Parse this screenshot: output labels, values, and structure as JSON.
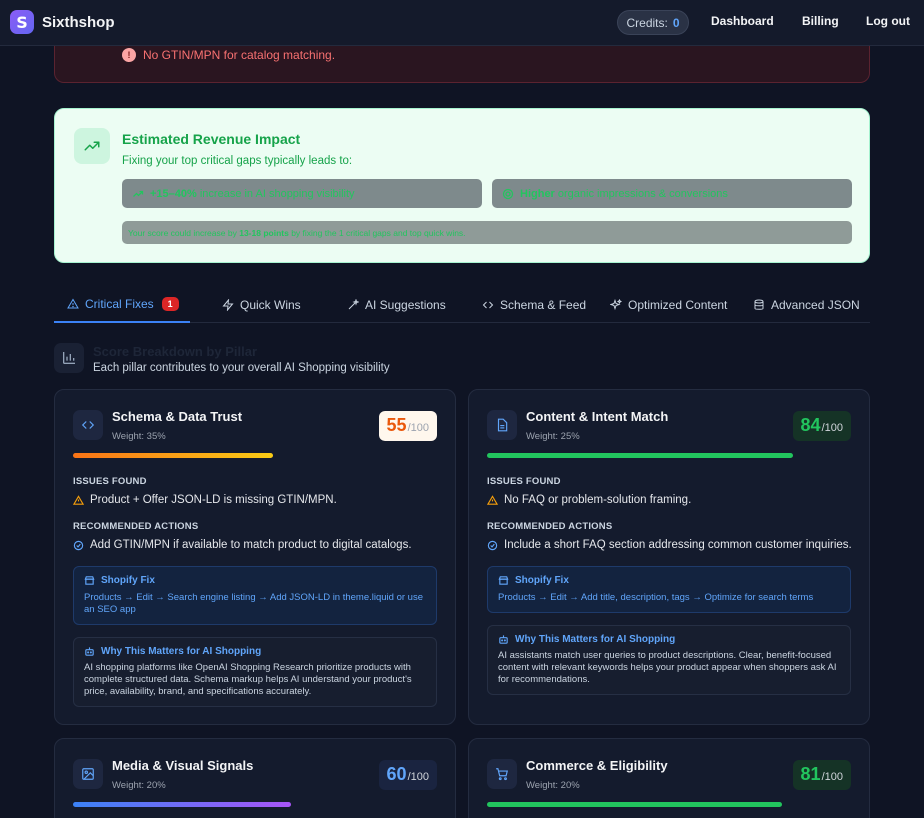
{
  "nav": {
    "brand": "Sixthshop",
    "credits_label": "Credits:",
    "credits_value": "0",
    "links": [
      "Dashboard",
      "Billing",
      "Log out"
    ]
  },
  "alert": {
    "badge": "!",
    "text": "No GTIN/MPN for catalog matching."
  },
  "revenue": {
    "title": "Estimated Revenue Impact",
    "subtitle": "Fixing your top critical gaps typically leads to:",
    "pill1_bold": "+15–40%",
    "pill1_text": "increase in AI shopping visibility",
    "pill2_bold": "Higher",
    "pill2_text": "organic impressions & conversions",
    "note_pre": "Your score could increase by",
    "note_bold": "13-18 points",
    "note_post": "by fixing the 1 critical gaps and top quick wins."
  },
  "tabs": {
    "items": [
      "Critical Fixes",
      "Quick Wins",
      "AI Suggestions",
      "Schema & Feed",
      "Optimized Content",
      "Advanced JSON"
    ],
    "active": "Critical Fixes",
    "critical_count": "1"
  },
  "breakdown": {
    "title": "Score Breakdown by Pillar",
    "subtitle": "Each pillar contributes to your overall AI Shopping visibility"
  },
  "cards": [
    {
      "title": "Schema & Data Trust",
      "weight": "Weight: 35%",
      "score": "55",
      "score_max": "/100",
      "score_fraction": 0.55,
      "issues_label": "ISSUES FOUND",
      "issue": "Product + Offer JSON-LD is missing GTIN/MPN.",
      "actions_label": "RECOMMENDED ACTIONS",
      "action": "Add GTIN/MPN if available to match product to digital catalogs.",
      "fix_title": "Shopify Fix",
      "fix_body": "Products → Edit → Search engine listing → Add JSON-LD in theme.liquid or use an SEO app",
      "why_title": "Why This Matters for AI Shopping",
      "why_body": "AI shopping platforms like OpenAI Shopping Research prioritize products with complete structured data. Schema markup helps AI understand your product's price, availability, brand, and specifications accurately."
    },
    {
      "title": "Content & Intent Match",
      "weight": "Weight: 25%",
      "score": "84",
      "score_max": "/100",
      "score_fraction": 0.84,
      "issues_label": "ISSUES FOUND",
      "issue": "No FAQ or problem-solution framing.",
      "actions_label": "RECOMMENDED ACTIONS",
      "action": "Include a short FAQ section addressing common customer inquiries.",
      "fix_title": "Shopify Fix",
      "fix_body": "Products → Edit → Add title, description, tags → Optimize for search terms",
      "why_title": "Why This Matters for AI Shopping",
      "why_body": "AI assistants match user queries to product descriptions. Clear, benefit-focused content with relevant keywords helps your product appear when shoppers ask AI for recommendations."
    },
    {
      "title": "Media & Visual Signals",
      "weight": "Weight: 20%",
      "score": "60",
      "score_max": "/100",
      "score_fraction": 0.6
    },
    {
      "title": "Commerce & Eligibility",
      "weight": "Weight: 20%",
      "score": "81",
      "score_max": "/100",
      "score_fraction": 0.81
    }
  ],
  "colors": {
    "accent": "#3b82f6",
    "warn_orange": "#f97316",
    "success_green": "#22c55e",
    "danger_red": "#dc2626"
  }
}
